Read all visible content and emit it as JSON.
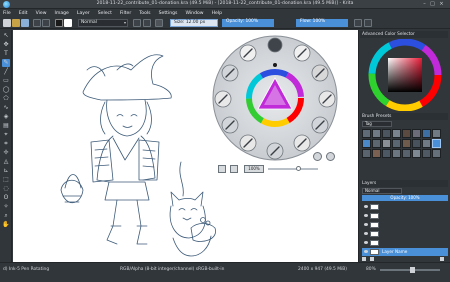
{
  "window": {
    "title": "2018-11-22_contribute_01-donation.kra (49.5 MiB) - [2018-11-22_contribute_01-donation.kra (49.5 MiB)] - Krita"
  },
  "menu": [
    "File",
    "Edit",
    "View",
    "Image",
    "Layer",
    "Select",
    "Filter",
    "Tools",
    "Settings",
    "Window",
    "Help"
  ],
  "toolbar": {
    "blend_mode": "Normal",
    "size_label": "Size:  12.00 px",
    "opacity_label": "Opacity:  100%",
    "flow_label": "Flow:  100%"
  },
  "popup_palette": {
    "zoom_label": "100%"
  },
  "dock": {
    "color_selector_title": "Advanced Color Selector",
    "brush_presets_title": "Brush Presets",
    "brush_tag": "Tag",
    "layers_title": "Layers",
    "layer_blend": "Normal",
    "layer_opacity": "Opacity:  100%",
    "layers": [
      "",
      "",
      "",
      "",
      "",
      "",
      "Layer Name"
    ]
  },
  "status": {
    "brush": "d) Ink-5 Pen Rotating",
    "color_space": "RGB/Alpha (8-bit integer/channel)  sRGB-built-in",
    "dimensions": "2400 x 947 (49.5 MiB)",
    "zoom": "80%"
  },
  "colors": {
    "accent": "#4a90d9",
    "background": "#31363b",
    "canvas": "#ffffff"
  }
}
